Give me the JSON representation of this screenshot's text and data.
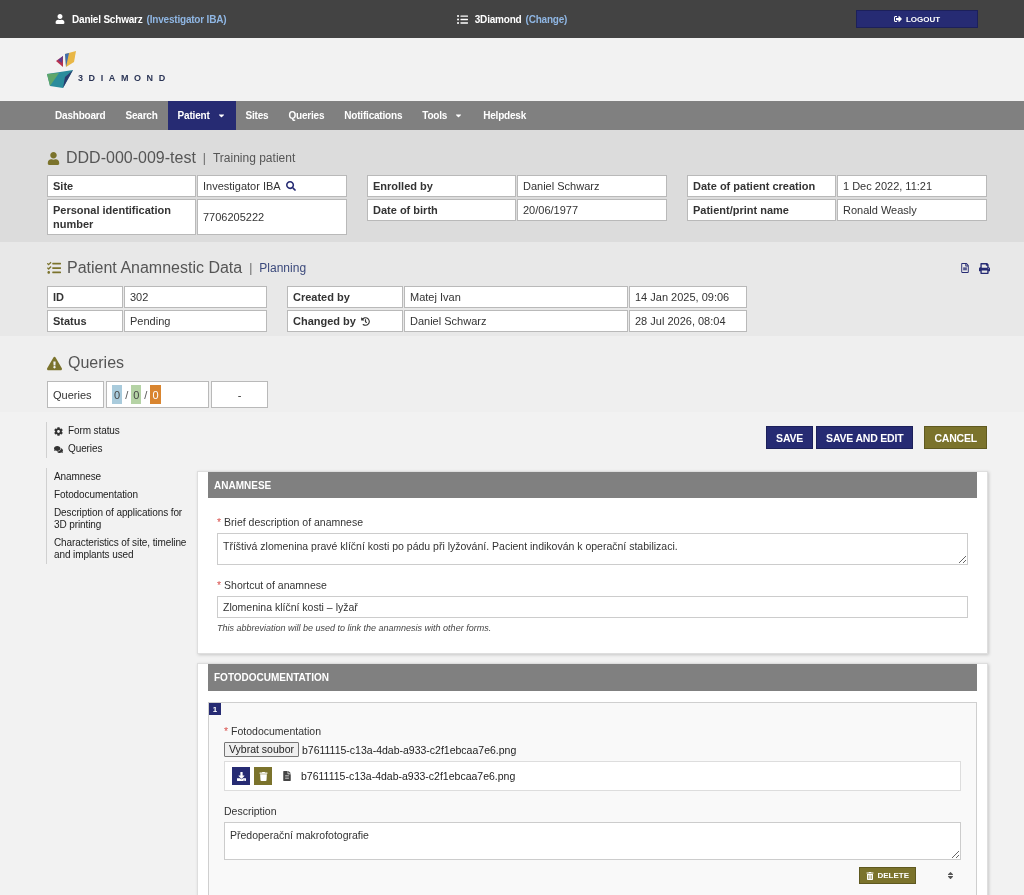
{
  "top_bar": {
    "user_name": "Daniel Schwarz",
    "user_role": "(Investigator IBA)",
    "project_name": "3Diamond",
    "project_action": "(Change)",
    "logout": "LOGOUT"
  },
  "logo": {
    "text": "3DIAMOND"
  },
  "nav": [
    {
      "label": "Dashboard",
      "selected": false,
      "dropdown": false
    },
    {
      "label": "Search",
      "selected": false,
      "dropdown": false
    },
    {
      "label": "Patient",
      "selected": true,
      "dropdown": true
    },
    {
      "label": "Sites",
      "selected": false,
      "dropdown": false
    },
    {
      "label": "Queries",
      "selected": false,
      "dropdown": false
    },
    {
      "label": "Notifications",
      "selected": false,
      "dropdown": false
    },
    {
      "label": "Tools",
      "selected": false,
      "dropdown": true
    },
    {
      "label": "Helpdesk",
      "selected": false,
      "dropdown": false
    }
  ],
  "patient": {
    "title": "DDD-000-009-test",
    "separator": "|",
    "subtitle": "Training patient",
    "groups": [
      {
        "rows": [
          {
            "cells": [
              {
                "kind": "label",
                "text": "Site"
              },
              {
                "kind": "lookup",
                "text": "Investigator IBA"
              }
            ]
          },
          {
            "cells": [
              {
                "kind": "label",
                "text": "Personal identification number"
              },
              {
                "kind": "value",
                "text": "7706205222"
              }
            ]
          }
        ]
      },
      {
        "rows": [
          {
            "cells": [
              {
                "kind": "label",
                "text": "Enrolled by"
              },
              {
                "kind": "value",
                "text": "Daniel Schwarz"
              }
            ]
          },
          {
            "cells": [
              {
                "kind": "label",
                "text": "Date of birth"
              },
              {
                "kind": "value",
                "text": "20/06/1977"
              }
            ]
          }
        ]
      },
      {
        "rows": [
          {
            "cells": [
              {
                "kind": "label",
                "text": "Date of patient creation"
              },
              {
                "kind": "value",
                "text": "1 Dec 2022, 11:21"
              }
            ]
          },
          {
            "cells": [
              {
                "kind": "label",
                "text": "Patient/print name"
              },
              {
                "kind": "value",
                "text": "Ronald Weasly"
              }
            ]
          }
        ]
      }
    ]
  },
  "form": {
    "title": "Patient Anamnestic Data",
    "separator": "|",
    "subtitle": "Planning",
    "groups": [
      {
        "rows": [
          {
            "cells": [
              {
                "kind": "label",
                "text": "ID"
              },
              {
                "kind": "value",
                "text": "302"
              }
            ]
          },
          {
            "cells": [
              {
                "kind": "label",
                "text": "Status"
              },
              {
                "kind": "value",
                "text": "Pending"
              }
            ]
          }
        ]
      },
      {
        "rows": [
          {
            "cells": [
              {
                "kind": "label",
                "text": "Created by"
              },
              {
                "kind": "value",
                "text": "Matej Ivan"
              },
              {
                "kind": "value",
                "text": "14 Jan 2025, 09:06"
              }
            ]
          },
          {
            "cells": [
              {
                "kind": "history",
                "text": "Changed by"
              },
              {
                "kind": "value",
                "text": "Daniel Schwarz"
              },
              {
                "kind": "value",
                "text": "28 Jul 2026, 08:04"
              }
            ]
          }
        ]
      }
    ]
  },
  "queries": {
    "title": "Queries",
    "label": "Queries",
    "counts": [
      {
        "value": "0",
        "color": "#a9cbdc"
      },
      {
        "value": "0",
        "color": "#b5d3a5"
      },
      {
        "value": "0",
        "color": "#d9852f"
      }
    ],
    "separators": [
      "/",
      "/"
    ],
    "extra": "-"
  },
  "sidebar": {
    "tools": [
      {
        "kind": "status",
        "label": "Form status"
      },
      {
        "kind": "comments",
        "label": "Queries"
      }
    ],
    "sections": [
      {
        "label": "Anamnese"
      },
      {
        "label": "Fotodocumentation"
      },
      {
        "label": "Description of applications for 3D printing"
      },
      {
        "label": "Characteristics of site, timeline and implants used"
      }
    ]
  },
  "actions": [
    {
      "kind": "primary",
      "label": "SAVE"
    },
    {
      "kind": "primary",
      "label": "SAVE AND EDIT"
    },
    {
      "kind": "secondary",
      "label": "CANCEL"
    }
  ],
  "anamnese": {
    "title": "ANAMNESE",
    "fields": [
      {
        "kind": "textarea",
        "required_mark": "*",
        "label": "Brief description of anamnese",
        "value": "Tříštivá zlomenina pravé klíční kosti po pádu při lyžování. Pacient indikován k operační stabilizaci."
      },
      {
        "kind": "input",
        "required_mark": "*",
        "label": "Shortcut of anamnese",
        "value": "Zlomenina klíční kosti – lyžař",
        "help": "This abbreviation will be used to link the anamnesis with other forms."
      }
    ]
  },
  "fotodocumentation": {
    "title": "FOTODOCUMENTATION",
    "entries": [
      {
        "number": "1",
        "required_mark": "*",
        "file_label": "Fotodocumentation",
        "choose_button": "Vybrat soubor",
        "chosen_file": "b7611115-c13a-4dab-a933-c2f1ebcaa7e6.png",
        "uploaded_file": "b7611115-c13a-4dab-a933-c2f1ebcaa7e6.png",
        "description_label": "Description",
        "description": "Předoperační makrofotografie",
        "delete": "DELETE"
      }
    ]
  }
}
